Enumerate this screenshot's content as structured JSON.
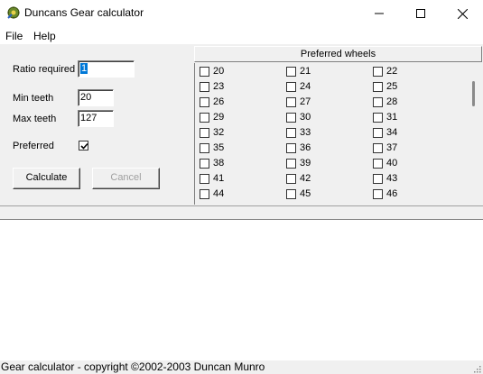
{
  "window": {
    "title": "Duncans Gear calculator"
  },
  "menu": {
    "file": "File",
    "help": "Help"
  },
  "form": {
    "ratio_label": "Ratio required",
    "ratio_value": "1",
    "min_teeth_label": "Min teeth",
    "min_teeth_value": "20",
    "max_teeth_label": "Max teeth",
    "max_teeth_value": "127",
    "preferred_label": "Preferred",
    "preferred_checked": true,
    "calculate_label": "Calculate",
    "cancel_label": "Cancel"
  },
  "wheels": {
    "header": "Preferred wheels",
    "items": [
      "20",
      "21",
      "22",
      "23",
      "24",
      "25",
      "26",
      "27",
      "28",
      "29",
      "30",
      "31",
      "32",
      "33",
      "34",
      "35",
      "36",
      "37",
      "38",
      "39",
      "40",
      "41",
      "42",
      "43",
      "44",
      "45",
      "46"
    ]
  },
  "status": {
    "text": "Gear calculator - copyright ©2002-2003 Duncan Munro"
  },
  "colors": {
    "accent": "#0078d7",
    "window_bg": "#f0f0f0"
  }
}
